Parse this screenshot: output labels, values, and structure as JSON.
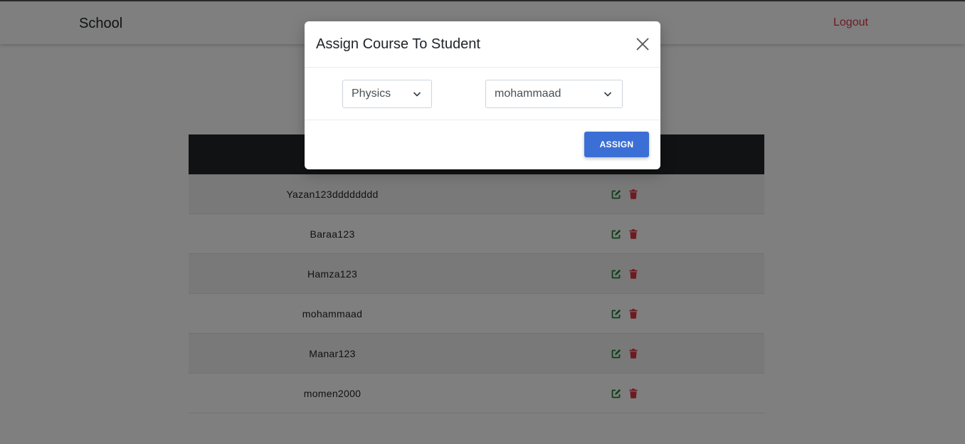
{
  "navbar": {
    "brand": "School",
    "logout_label": "Logout"
  },
  "students": [
    {
      "name": "Yazan123dddddddd"
    },
    {
      "name": "Baraa123"
    },
    {
      "name": "Hamza123"
    },
    {
      "name": "mohammaad"
    },
    {
      "name": "Manar123"
    },
    {
      "name": "momen2000"
    }
  ],
  "row_icons": {
    "edit": "edit-icon",
    "delete": "trash-icon"
  },
  "modal": {
    "title": "Assign Course To Student",
    "course_select": {
      "value": "Physics"
    },
    "student_select": {
      "value": "mohammaad"
    },
    "assign_label": "ASSIGN"
  },
  "colors": {
    "logout": "#dc3545",
    "edit": "#1e7e34",
    "delete": "#dc3545",
    "assign": "#3c6fd6",
    "table_header": "#212529"
  }
}
